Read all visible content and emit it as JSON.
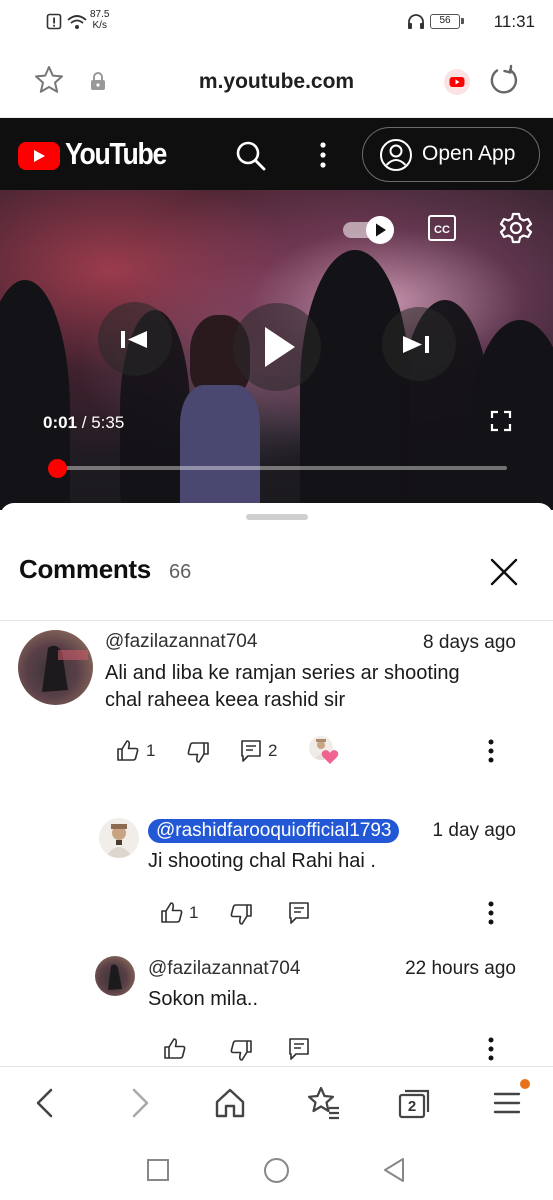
{
  "status_bar": {
    "speed_value": "87.5",
    "speed_unit": "K/s",
    "battery": "56",
    "time": "11:31"
  },
  "browser": {
    "url": "m.youtube.com",
    "tab_count": "2"
  },
  "youtube": {
    "brand": "YouTube",
    "open_app_label": "Open App"
  },
  "player": {
    "current_time": "0:01",
    "separator": " / ",
    "duration": "5:35",
    "progress": 0.003,
    "cc_label": "CC"
  },
  "comments": {
    "title": "Comments",
    "count": "66",
    "items": [
      {
        "author": "@fazilazannat704",
        "time_ago": "8 days ago",
        "text_line1": "Ali and liba ke  ramjan  series  ar shooting",
        "text_line2": "chal raheea keea rashid sir",
        "likes": "1",
        "replies": "2"
      },
      {
        "author": "@rashidfarooquiofficial1793",
        "time_ago": "1 day ago",
        "text": "Ji shooting chal Rahi hai .",
        "likes": "1"
      },
      {
        "author": "@fazilazannat704",
        "time_ago": "22 hours ago",
        "text": "Sokon mila.."
      }
    ]
  },
  "colors": {
    "brand_red": "#ff0000",
    "header_bg": "#0f0f0f",
    "mention_bg": "#2258d6",
    "notification_dot": "#e8711a"
  }
}
